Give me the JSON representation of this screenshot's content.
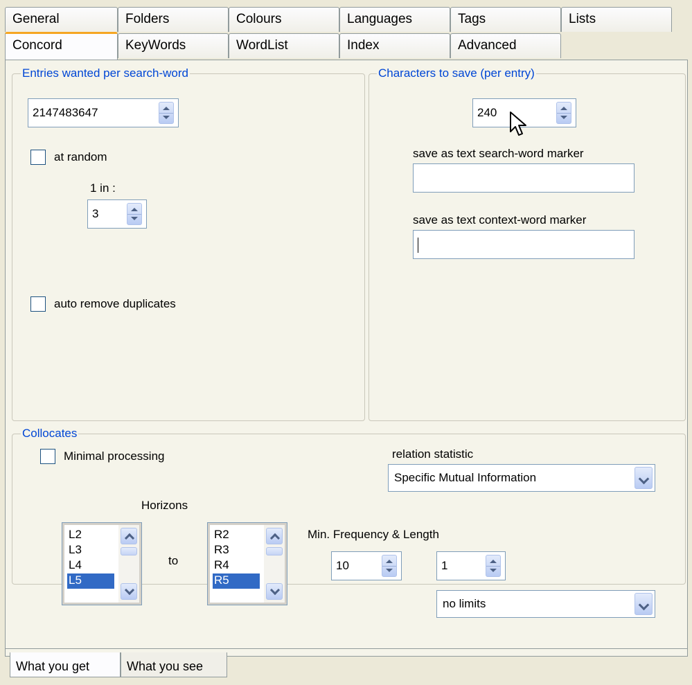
{
  "tabs_row1": [
    "General",
    "Folders",
    "Colours",
    "Languages",
    "Tags",
    "Lists"
  ],
  "tabs_row2": [
    "Concord",
    "KeyWords",
    "WordList",
    "Index",
    "Advanced"
  ],
  "entries": {
    "legend": "Entries wanted per search-word",
    "value": "2147483647",
    "at_random_label": "at random",
    "one_in_label": "1 in :",
    "one_in_value": "3",
    "auto_remove_label": "auto remove duplicates"
  },
  "chars": {
    "legend": "Characters to save (per entry)",
    "value": "240",
    "search_marker_label": "save as text search-word marker",
    "search_marker_value": "",
    "context_marker_label": "save as text context-word marker",
    "context_marker_value": ""
  },
  "collocates": {
    "legend": "Collocates",
    "minimal_label": "Minimal processing",
    "relation_label": "relation statistic",
    "relation_value": "Specific Mutual Information",
    "horizons_label": "Horizons",
    "to_label": "to",
    "left_items": [
      "L2",
      "L3",
      "L4",
      "L5"
    ],
    "left_selected": "L5",
    "right_items": [
      "R2",
      "R3",
      "R4",
      "R5"
    ],
    "right_selected": "R5",
    "minfreq_label": "Min. Frequency &  Length",
    "minfreq_value": "10",
    "length_value": "1",
    "limits_value": "no limits"
  },
  "bottom_tabs": [
    "What you get",
    "What you see"
  ]
}
